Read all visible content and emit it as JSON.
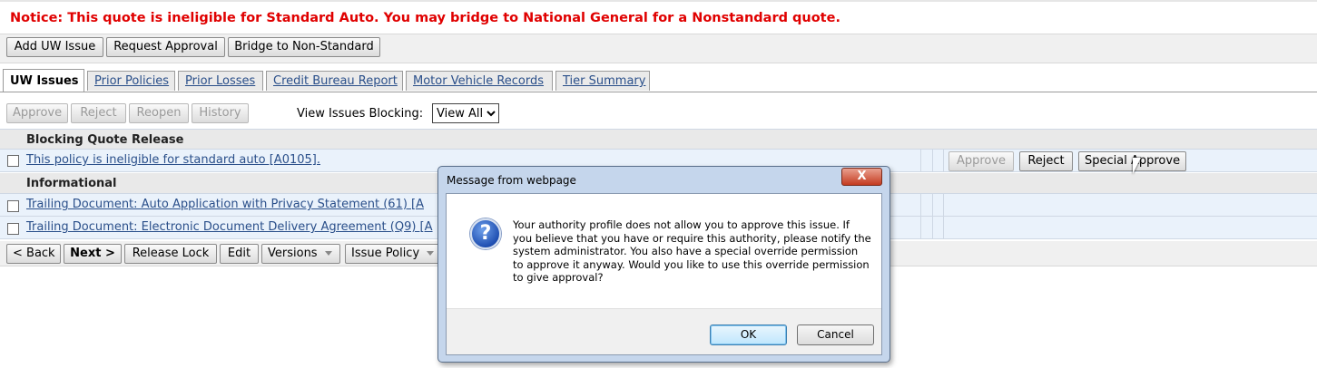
{
  "notice": "Notice: This quote is ineligible for Standard Auto. You may bridge to National General for a Nonstandard quote.",
  "top_actions": [
    "Add UW Issue",
    "Request Approval",
    "Bridge to Non-Standard"
  ],
  "tabs": [
    "UW Issues",
    "Prior Policies",
    "Prior Losses",
    "Credit Bureau Report",
    "Motor Vehicle Records",
    "Tier Summary"
  ],
  "issue_toolbar": {
    "buttons": [
      "Approve",
      "Reject",
      "Reopen",
      "History"
    ],
    "filter_label": "View Issues Blocking:",
    "filter_value": "View All"
  },
  "sections": {
    "blocking": {
      "title": "Blocking Quote Release",
      "items": [
        {
          "text": "This policy is ineligible for standard auto [A0105].",
          "actions": [
            "Approve",
            "Reject",
            "Special Approve"
          ]
        }
      ]
    },
    "informational": {
      "title": "Informational",
      "items": [
        {
          "text": "Trailing Document: Auto Application with Privacy Statement (61) [A"
        },
        {
          "text": "Trailing Document: Electronic Document Delivery Agreement (Q9) [A"
        }
      ]
    }
  },
  "bottom_actions": {
    "back": "< Back",
    "next": "Next >",
    "release": "Release Lock",
    "edit": "Edit",
    "versions": "Versions",
    "issue_policy": "Issue Policy"
  },
  "dialog": {
    "title": "Message from webpage",
    "close": "X",
    "icon": "question-icon",
    "message": "Your authority profile does not allow you to approve this issue. If you believe that you have or require this authority, please notify the system administrator. You also have a special override permission to approve it anyway. Would you like to use this override permission to give approval?",
    "ok": "OK",
    "cancel": "Cancel"
  },
  "colors": {
    "notice": "#e00000",
    "link": "#2a4f8a",
    "row_bg": "#eaf2fb"
  }
}
